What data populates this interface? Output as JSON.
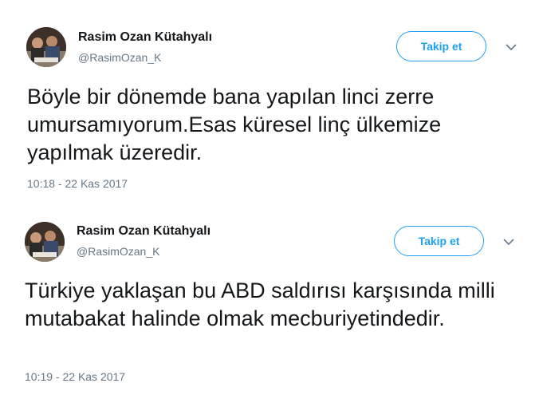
{
  "tweets": [
    {
      "author": {
        "name": "Rasim Ozan Kütahyalı",
        "handle": "@RasimOzan_K"
      },
      "follow_label": "Takip et",
      "text": "Böyle bir dönemde bana yapılan linci zerre umursamıyorum.Esas küresel linç ülkemize yapılmak üzeredir.",
      "timestamp": "10:18 - 22 Kas 2017"
    },
    {
      "author": {
        "name": "Rasim Ozan Kütahyalı",
        "handle": "@RasimOzan_K"
      },
      "follow_label": "Takip et",
      "text": "Türkiye yaklaşan bu ABD saldırısı karşısında milli mutabakat halinde olmak mecburiyetindedir.",
      "timestamp": "10:19 - 22 Kas 2017"
    }
  ],
  "colors": {
    "accent": "#1da1f2",
    "secondary_text": "#657786",
    "primary_text": "#14171a"
  },
  "icons": {
    "menu": "chevron-down-icon"
  }
}
